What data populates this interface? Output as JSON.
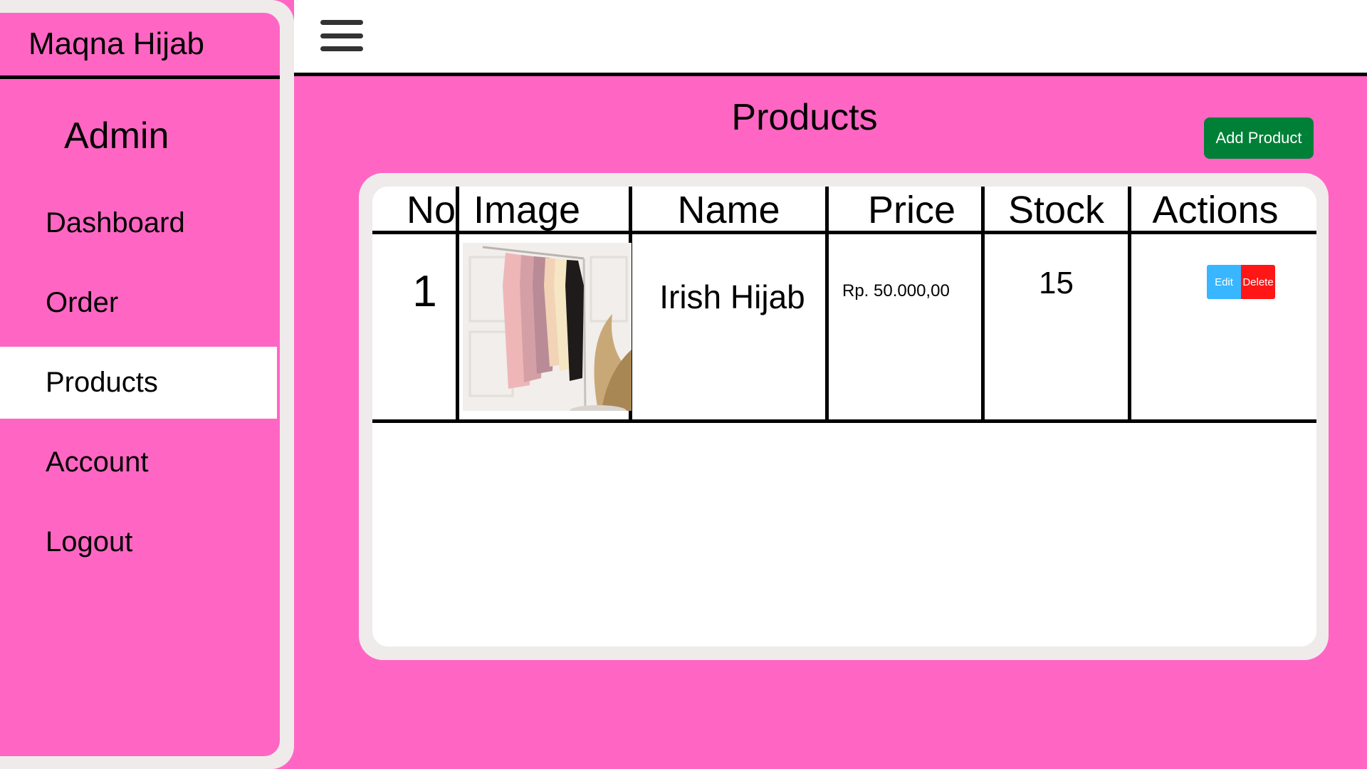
{
  "sidebar": {
    "brand": "Maqna Hijab",
    "role": "Admin",
    "items": [
      {
        "label": "Dashboard",
        "active": false
      },
      {
        "label": "Order",
        "active": false
      },
      {
        "label": "Products",
        "active": true
      },
      {
        "label": "Account",
        "active": false
      },
      {
        "label": "Logout",
        "active": false
      }
    ]
  },
  "topbar": {
    "menu_icon": "hamburger-menu-icon"
  },
  "main": {
    "title": "Products",
    "add_button": "Add Product"
  },
  "table": {
    "headers": [
      "No",
      "Image",
      "Name",
      "Price",
      "Stock",
      "Actions"
    ],
    "rows": [
      {
        "no": "1",
        "image": "product-photo-hijabs-on-rack",
        "name": "Irish Hijab",
        "price": "Rp. 50.000,00",
        "stock": "15",
        "actions": {
          "edit": "Edit",
          "delete": "Delete"
        }
      }
    ]
  },
  "colors": {
    "background": "#FF66C4",
    "panel": "#EFEBEB",
    "add_button": "#008037",
    "edit_button": "#38B6FF",
    "delete_button": "#FF1616"
  }
}
